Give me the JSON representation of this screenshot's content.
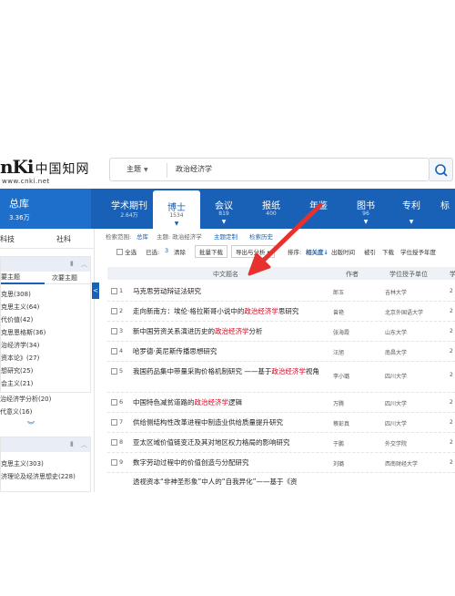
{
  "header": {
    "logo_latin": "nKi",
    "logo_cn": "中国知网",
    "logo_url": "www.cnki.net",
    "search_type": "主题",
    "search_query": "政治经济学"
  },
  "tabs": {
    "total": {
      "label": "总库",
      "count": "3.36万"
    },
    "items": [
      {
        "label": "学术期刊",
        "count": "2.64万",
        "active": false
      },
      {
        "label": "博士",
        "count": "1534",
        "active": true
      },
      {
        "label": "会议",
        "count": "819",
        "active": false
      },
      {
        "label": "报纸",
        "count": "400",
        "active": false
      },
      {
        "label": "年鉴",
        "count": "",
        "active": false
      },
      {
        "label": "图书",
        "count": "96",
        "active": false
      },
      {
        "label": "专利",
        "count": "",
        "active": false
      },
      {
        "label": "标",
        "count": "",
        "active": false
      }
    ]
  },
  "left": {
    "top_a": "科技",
    "top_b": "社科",
    "collapse": "<",
    "facet1": {
      "tab_on": "要主题",
      "tab_off": "次要主题",
      "items": [
        "克思(308)",
        "克思主义(64)",
        "代价值(42)",
        "克思恩格斯(36)",
        "治经济学(34)",
        "资本论》(27)",
        "想研究(25)",
        "会主义(21)",
        "治经济学分析(20)",
        "代意义(16)"
      ]
    },
    "facet2": {
      "items": [
        "克思主义(303)",
        "济理论及经济思想史(228)"
      ]
    }
  },
  "content": {
    "crumb": {
      "scope_label": "检索范围:",
      "scope_value": "总库",
      "topic": "主题: 政治经济学",
      "custom": "主题定制",
      "history": "检索历史"
    },
    "toolbar": {
      "select_all": "全选",
      "selected": "已选:",
      "selected_count": "3",
      "clear": "清除",
      "batch_download": "批量下载",
      "export": "导出与分析 ▾",
      "sort": "排序:",
      "sort_relevance": "相关度↓",
      "sort_pub": "出版时间",
      "sort_cited": "被引",
      "sort_dl": "下载",
      "sort_year": "学位授予年度"
    },
    "columns": {
      "title": "中文题名",
      "author": "作者",
      "unit": "学位授予单位",
      "year": "学"
    },
    "rows": [
      {
        "num": "1",
        "pre": "马克思劳动辩证法研究",
        "hl": "",
        "post": "",
        "author": "郎玉",
        "unit": "吉林大学",
        "year": "2"
      },
      {
        "num": "2",
        "pre": "走向新南方：埃伦·格拉斯哥小说中的",
        "hl": "政治经济学",
        "post": "思研究",
        "author": "曾艳",
        "unit": "北京外国语大学",
        "year": "2"
      },
      {
        "num": "3",
        "pre": "新中国劳资关系演进历史的",
        "hl": "政治经济学",
        "post": "分析",
        "author": "张海霞",
        "unit": "山东大学",
        "year": "2"
      },
      {
        "num": "4",
        "pre": "哈罗德·英尼斯传播思想研究",
        "hl": "",
        "post": "",
        "author": "汪旭",
        "unit": "南昌大学",
        "year": "2"
      },
      {
        "num": "5",
        "pre": "我国药品集中带量采购价格机制研究 ——基于",
        "hl": "政治经济学",
        "post": "视角",
        "author": "李小璐",
        "unit": "四川大学",
        "year": "2"
      },
      {
        "num": "6",
        "pre": "中国特色减贫道路的",
        "hl": "政治经济学",
        "post": "逻辑",
        "author": "万腾",
        "unit": "四川大学",
        "year": "2"
      },
      {
        "num": "7",
        "pre": "供给侧结构性改革进程中制造业供给质量提升研究",
        "hl": "",
        "post": "",
        "author": "蔡彭真",
        "unit": "四川大学",
        "year": "2"
      },
      {
        "num": "8",
        "pre": "亚太区域价值链变迁及其对地区权力格局的影响研究",
        "hl": "",
        "post": "",
        "author": "于鹏",
        "unit": "外交学院",
        "year": "2"
      },
      {
        "num": "9",
        "pre": "数字劳动过程中的价值创造与分配研究",
        "hl": "",
        "post": "",
        "author": "刘璐",
        "unit": "西南财经大学",
        "year": "2"
      },
      {
        "num": "10",
        "pre": "透视资本“非神圣形象”中人的“自我异化”——基于《资",
        "hl": "",
        "post": "",
        "author": "",
        "unit": "",
        "year": ""
      }
    ]
  },
  "annotation": {
    "color": "#e8312c"
  }
}
